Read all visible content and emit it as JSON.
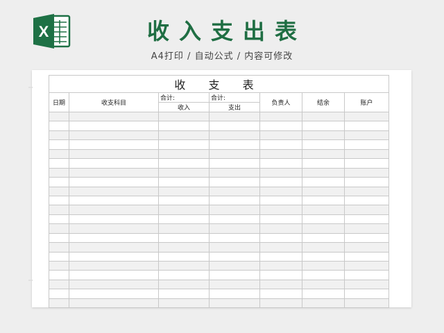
{
  "header": {
    "title": "收入支出表",
    "subtitle": "A4打印 / 自动公式 / 内容可修改",
    "logo_letter": "X",
    "logo_icon": "excel-icon",
    "brand_color": "#1f6e43"
  },
  "sheet": {
    "title": "收 支 表",
    "columns": {
      "date": "日期",
      "subject": "收支科目",
      "sum_income_label": "合计:",
      "sum_expense_label": "合计:",
      "income": "收入",
      "expense": "支出",
      "person": "负责人",
      "settled": "结余",
      "account": "账户"
    },
    "empty_rows": 21
  }
}
